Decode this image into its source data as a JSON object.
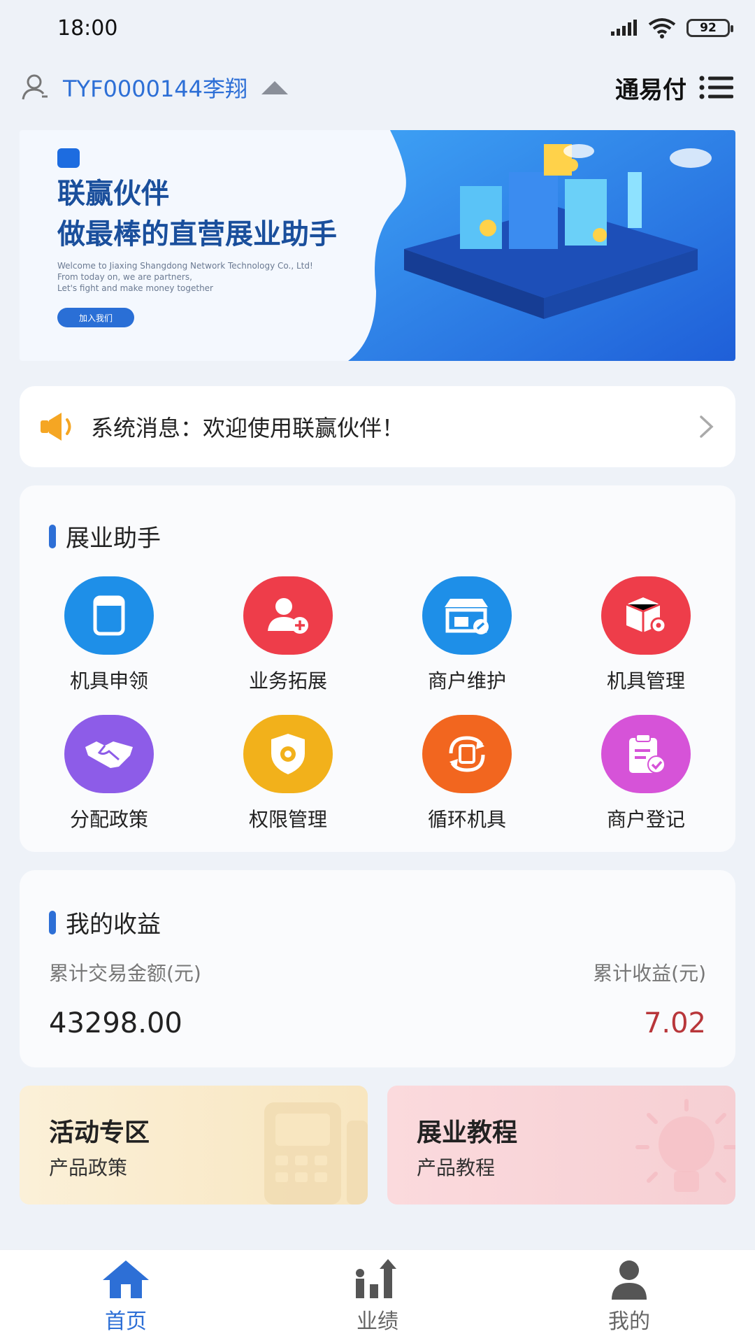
{
  "status_bar": {
    "time": "18:00",
    "battery": "92"
  },
  "header": {
    "account": "TYF0000144李翔",
    "title": "通易付"
  },
  "banner": {
    "title_line1": "联赢伙伴",
    "title_line2": "做最棒的直营展业助手",
    "sub_line1": "Welcome to Jiaxing Shangdong Network Technology Co., Ltd!",
    "sub_line2": "From today on, we are partners,",
    "sub_line3": "Let's fight and make money together",
    "join_label": "加入我们"
  },
  "notice": {
    "text": "系统消息：欢迎使用联赢伙伴！"
  },
  "assistant": {
    "title": "展业助手",
    "items": [
      {
        "label": "机具申领",
        "icon": "device-apply-icon",
        "color": "#1e8fe8"
      },
      {
        "label": "业务拓展",
        "icon": "add-user-icon",
        "color": "#ee3d4a"
      },
      {
        "label": "商户维护",
        "icon": "store-maintenance-icon",
        "color": "#1e8fe8"
      },
      {
        "label": "机具管理",
        "icon": "box-settings-icon",
        "color": "#ee3d4a"
      },
      {
        "label": "分配政策",
        "icon": "handshake-icon",
        "color": "#8d5ce8"
      },
      {
        "label": "权限管理",
        "icon": "shield-gear-icon",
        "color": "#f2b11b"
      },
      {
        "label": "循环机具",
        "icon": "cycle-device-icon",
        "color": "#f2661f"
      },
      {
        "label": "商户登记",
        "icon": "clipboard-check-icon",
        "color": "#d653d8"
      }
    ]
  },
  "earnings": {
    "title": "我的收益",
    "total_amount_label": "累计交易金额(元)",
    "total_amount_value": "43298.00",
    "total_income_label": "累计收益(元)",
    "total_income_value": "7.02",
    "income_color": "#b8363a"
  },
  "promos": [
    {
      "title": "活动专区",
      "subtitle": "产品政策"
    },
    {
      "title": "展业教程",
      "subtitle": "产品教程"
    }
  ],
  "tabbar": {
    "active_color": "#2d6fd6",
    "items": [
      {
        "label": "首页",
        "icon": "home-icon"
      },
      {
        "label": "业绩",
        "icon": "performance-chart-icon"
      },
      {
        "label": "我的",
        "icon": "profile-icon"
      }
    ]
  }
}
